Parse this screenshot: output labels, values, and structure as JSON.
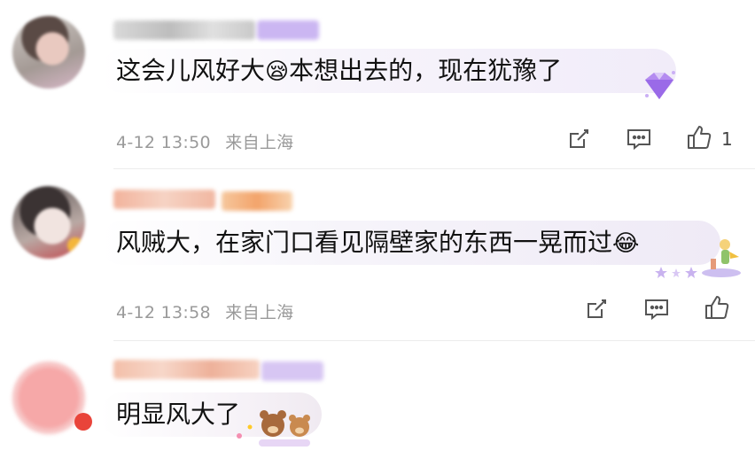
{
  "comments": [
    {
      "text_before": "这会儿风好大",
      "emoji": "😪",
      "text_after": "本想出去的，现在犹豫了",
      "date": "4-12 13:50",
      "location": "来自上海",
      "likes": "1"
    },
    {
      "text_before": "风贼大，在家门口看见隔壁家的东西一晃而过",
      "emoji": "😂",
      "text_after": "",
      "date": "4-12 13:58",
      "location": "来自上海",
      "likes": ""
    },
    {
      "text_before": "明显风大了",
      "emoji": "",
      "text_after": "",
      "date": "",
      "location": "",
      "likes": ""
    }
  ],
  "icons": {
    "share": "share-icon",
    "comment": "comment-icon",
    "like": "thumbs-up-icon"
  },
  "colors": {
    "meta_text": "#9a9a9a",
    "icon_stroke": "#555555",
    "separator": "#ececec"
  }
}
